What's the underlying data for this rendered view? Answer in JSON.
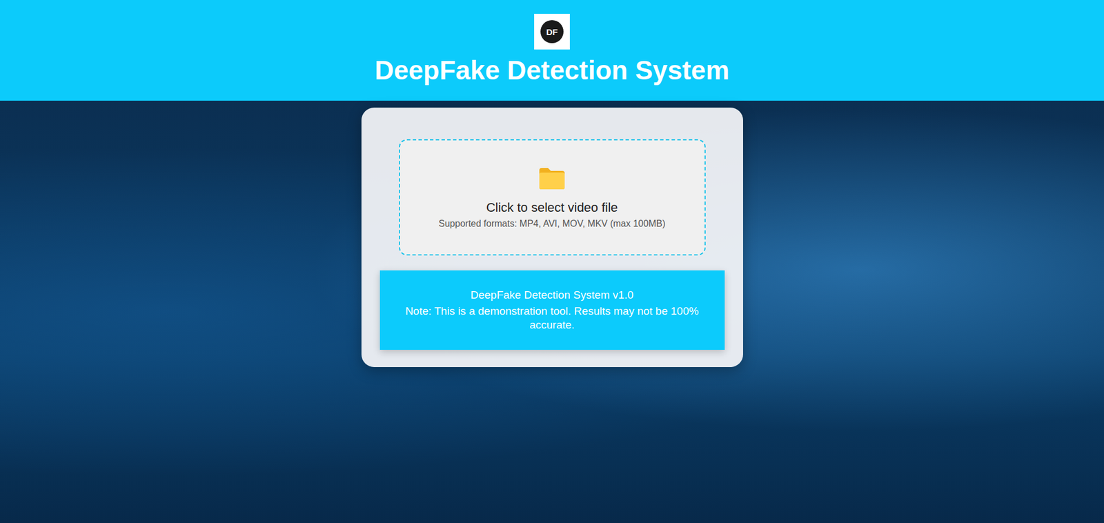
{
  "header": {
    "logo": "DF",
    "title": "DeepFake Detection System"
  },
  "upload": {
    "label": "Click to select video file",
    "hint": "Supported formats: MP4, AVI, MOV, MKV (max 100MB)"
  },
  "info": {
    "version": "DeepFake Detection System v1.0",
    "note": "Note: This is a demonstration tool. Results may not be 100% accurate."
  }
}
